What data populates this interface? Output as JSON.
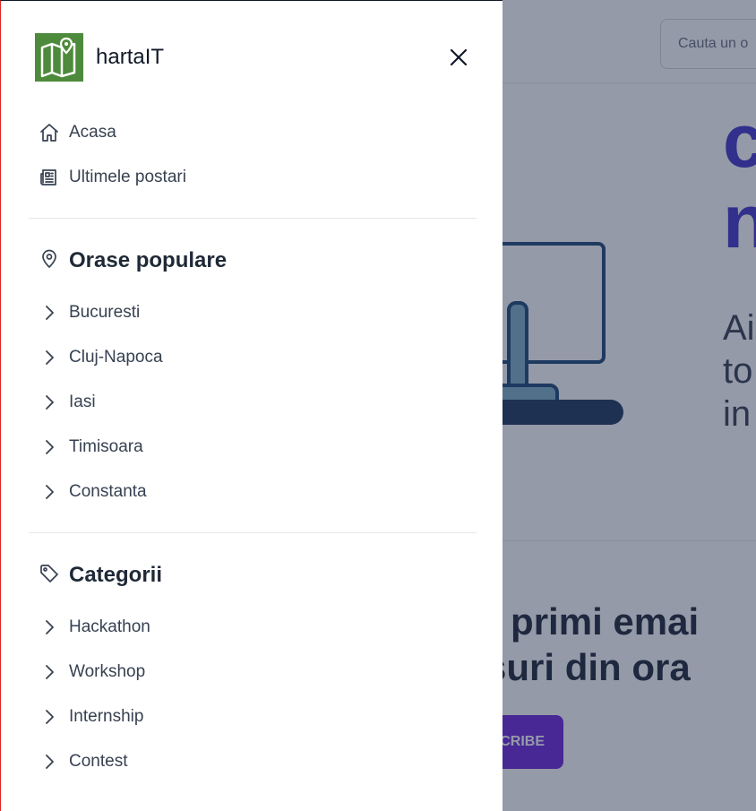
{
  "brand": {
    "name": "hartaIT",
    "logo_icon": "map-pin-icon",
    "logo_color": "#4d8a3b"
  },
  "drawer": {
    "close_icon": "close-icon",
    "main_links": [
      {
        "label": "Acasa",
        "icon": "home-icon"
      },
      {
        "label": "Ultimele postari",
        "icon": "newspaper-icon"
      }
    ],
    "cities": {
      "heading": "Orase populare",
      "icon": "map-pin-icon",
      "items": [
        "Bucuresti",
        "Cluj-Napoca",
        "Iasi",
        "Timisoara",
        "Constanta"
      ]
    },
    "categories": {
      "heading": "Categorii",
      "icon": "tag-icon",
      "items": [
        "Hackathon",
        "Workshop",
        "Internship",
        "Contest"
      ]
    }
  },
  "background": {
    "search_placeholder": "Cauta un o",
    "hero_title": "c\nn",
    "hero_subtitle": "Ai\nto\nin",
    "newsletter_text": "vei primi emai\nursuri din ora",
    "subscribe_label": "CRIBE",
    "accent_color": "#6d28d9"
  }
}
